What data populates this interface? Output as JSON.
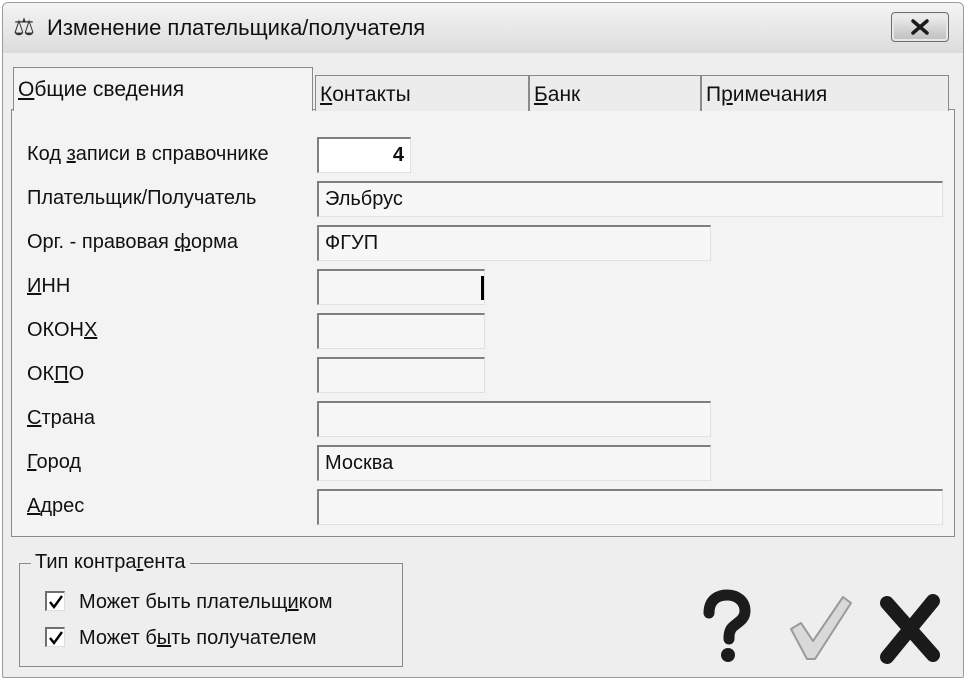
{
  "window": {
    "title": "Изменение плательщика/получателя",
    "app_icon_glyph": "⚖",
    "close_icon": "close-icon"
  },
  "tabs": [
    {
      "label_u": "О",
      "label_rest": "бщие сведения",
      "active": true
    },
    {
      "label_u": "К",
      "label_rest": "онтакты",
      "active": false
    },
    {
      "label_u": "Б",
      "label_rest": "анк",
      "active": false
    },
    {
      "label_pre": "П",
      "label_u": "р",
      "label_rest": "имечания",
      "active": false
    }
  ],
  "form": {
    "record_code": {
      "label_pre": "Код ",
      "label_u": "з",
      "label_rest": "аписи в справочнике",
      "value": "4"
    },
    "payer": {
      "label_pre": "Плательщик/Получатель",
      "value": "Эльбрус"
    },
    "legal_form": {
      "label_pre": "Орг. - правовая ",
      "label_u": "ф",
      "label_rest": "орма",
      "value": "ФГУП"
    },
    "inn": {
      "label_u": "И",
      "label_rest": "НН",
      "value": ""
    },
    "okonh": {
      "label_pre": "ОКОН",
      "label_u": "Х",
      "value": ""
    },
    "okpo": {
      "label_pre": "ОК",
      "label_u": "П",
      "label_rest": "О",
      "value": ""
    },
    "country": {
      "label_u": "С",
      "label_rest": "трана",
      "value": ""
    },
    "city": {
      "label_u": "Г",
      "label_rest": "ород",
      "value": "Москва"
    },
    "address": {
      "label_u": "А",
      "label_rest": "дрес",
      "value": ""
    }
  },
  "counterparty_type": {
    "title_pre": "Тип контра",
    "title_u": "г",
    "title_rest": "ента",
    "can_be_payer": {
      "label_pre": "Может быть плательщ",
      "label_u": "и",
      "label_rest": "ком",
      "checked": true
    },
    "can_be_receiver": {
      "label_pre": "Может б",
      "label_u": "ы",
      "label_rest": "ть получателем",
      "checked": true
    }
  },
  "actions": {
    "help_icon": "question-mark-icon",
    "ok_icon": "checkmark-icon",
    "cancel_icon": "x-icon"
  },
  "colors": {
    "window_bg": "#eeeeee",
    "field_bg": "#f7f7f7",
    "border": "#8a8a8a"
  }
}
